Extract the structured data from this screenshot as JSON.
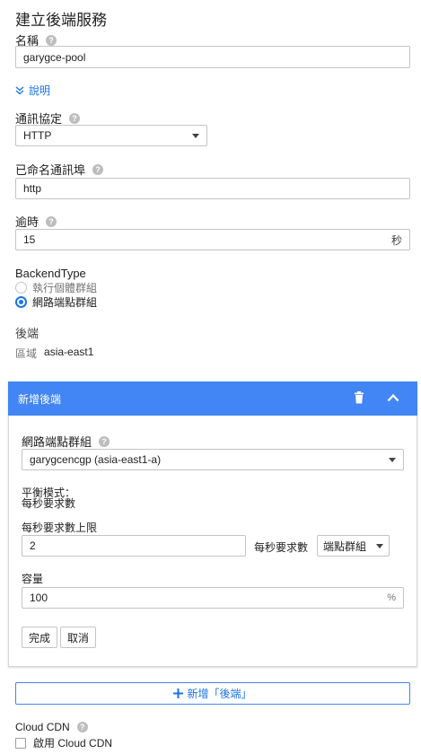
{
  "page": {
    "title": "建立後端服務"
  },
  "name_field": {
    "label": "名稱",
    "value": "garygce-pool"
  },
  "description_link": {
    "label": "說明"
  },
  "protocol": {
    "label": "通訊協定",
    "selected": "HTTP"
  },
  "named_port": {
    "label": "已命名通訊埠",
    "value": "http"
  },
  "timeout": {
    "label": "逾時",
    "value": "15",
    "unit": "秒"
  },
  "backend_type": {
    "label": "BackendType",
    "options": [
      "執行個體群組",
      "網路端點群組"
    ],
    "selected_index": 1
  },
  "backends": {
    "label": "後端",
    "region_label": "區域",
    "region_value": "asia-east1"
  },
  "new_backend_panel": {
    "header": "新增後端",
    "neg_label": "網路端點群組",
    "neg_selected": "garygcencgp (asia-east1-a)",
    "balancing_mode_label": "平衡模式：",
    "balancing_mode_value": "每秒要求數",
    "max_rps_label": "每秒要求數上限",
    "max_rps_value": "2",
    "max_rps_unit": "每秒要求數",
    "max_rps_scope": "端點群組",
    "capacity_label": "容量",
    "capacity_value": "100",
    "capacity_unit": "%",
    "done_label": "完成",
    "cancel_label": "取消"
  },
  "add_backend_button": {
    "label": "新增「後端」"
  },
  "cdn": {
    "label": "Cloud CDN",
    "checkbox_label": "啟用 Cloud CDN"
  },
  "colors": {
    "accent": "#4285f4",
    "link": "#1a73e8"
  }
}
